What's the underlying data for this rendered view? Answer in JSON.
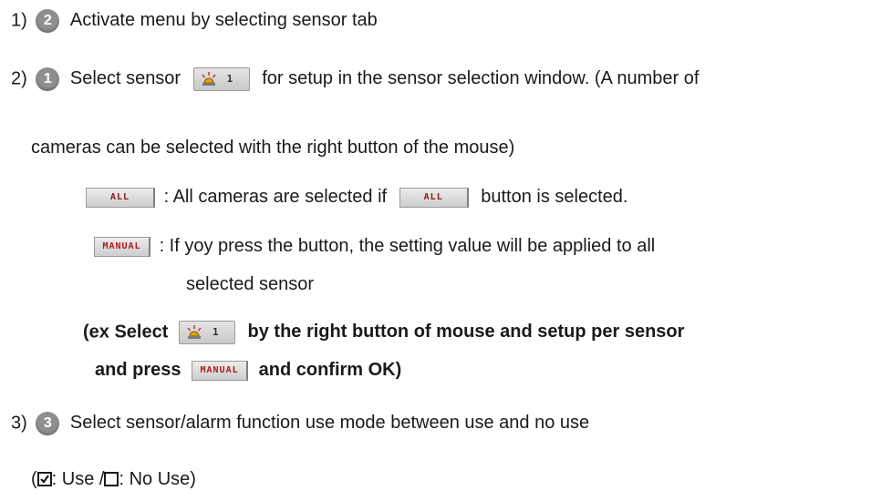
{
  "step1": {
    "prefix": "1)",
    "badge": "2",
    "text": "Activate menu by selecting sensor tab"
  },
  "step2": {
    "prefix": "2)",
    "badge": "1",
    "text_before": "Select sensor",
    "sensor_number": "1",
    "text_after": "for setup in the sensor selection window. (A number of",
    "continuation": "cameras can be selected with the right button of the mouse)"
  },
  "all_row": {
    "button_label": "ALL",
    "text_before": ": All cameras are selected if",
    "text_after": "button is selected."
  },
  "manual_row": {
    "button_label": "MANUAL",
    "text": ": If yoy press the button, the setting value will be applied to all",
    "continuation": "selected sensor"
  },
  "example": {
    "text_before": "(ex Select",
    "text_after": "by the right button of mouse and setup per sensor",
    "line2_before": "and press",
    "line2_after": "and confirm OK)"
  },
  "step3": {
    "prefix": "3)",
    "badge": "3",
    "text": "Select sensor/alarm function use mode between use and no use"
  },
  "legend": {
    "open": "(",
    "use": ": Use /",
    "no_use": ": No Use)"
  },
  "colors": {
    "badge": "#8f8f8f",
    "button_text": "#8a1a1a",
    "sensor_icon": "#e8a800"
  }
}
